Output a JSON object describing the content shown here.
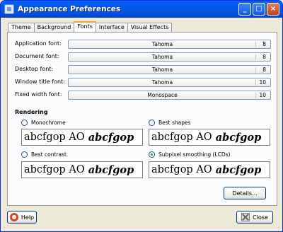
{
  "window": {
    "title": "Appearance Preferences"
  },
  "tabs": [
    "Theme",
    "Background",
    "Fonts",
    "Interface",
    "Visual Effects"
  ],
  "active_tab": "Fonts",
  "fonts": [
    {
      "label": "Application font:",
      "name": "Tahoma",
      "size": "8"
    },
    {
      "label": "Document font:",
      "name": "Tahoma",
      "size": "8"
    },
    {
      "label": "Desktop font:",
      "name": "Tahoma",
      "size": "8"
    },
    {
      "label": "Window title font:",
      "name": "Tahoma",
      "size": "10"
    },
    {
      "label": "Fixed width font:",
      "name": "Monospace",
      "size": "10"
    }
  ],
  "rendering": {
    "title": "Rendering",
    "options": [
      {
        "label": "Monochrome",
        "selected": false,
        "sample_regular": "abcfgop AO",
        "sample_bold": "abcfgop"
      },
      {
        "label": "Best shapes",
        "selected": false,
        "sample_regular": "abcfgop AO",
        "sample_bold": "abcfgop"
      },
      {
        "label": "Best contrast",
        "selected": false,
        "sample_regular": "abcfgop AO",
        "sample_bold": "abcfgop"
      },
      {
        "label": "Subpixel smoothing (LCDs)",
        "selected": true,
        "sample_regular": "abcfgop AO",
        "sample_bold": "abcfgop"
      }
    ]
  },
  "buttons": {
    "details": "Details...",
    "help": "Help",
    "close": "Close"
  },
  "titlebar_buttons": {
    "minimize": "_",
    "maximize": "□",
    "close": "×"
  },
  "colors": {
    "titlebar": "#0058ee",
    "window_bg": "#ece9d8",
    "active_tab_accent": "#f0a232",
    "selected_radio": "#2a9b2a"
  }
}
